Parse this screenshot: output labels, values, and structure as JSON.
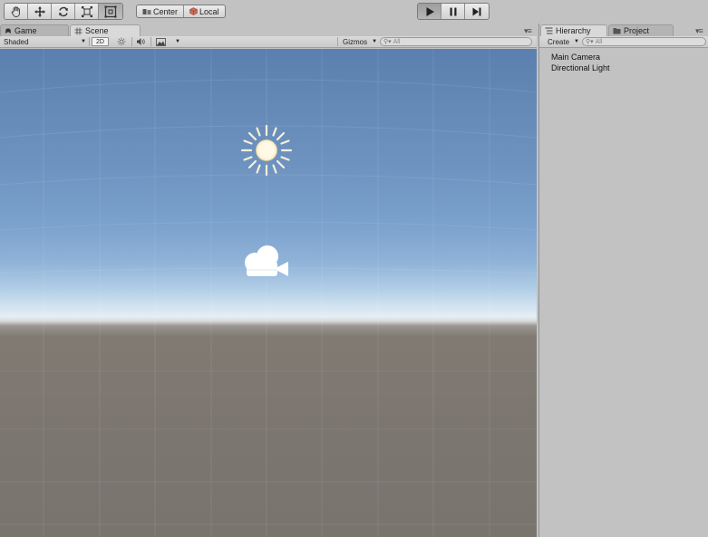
{
  "toolbar": {
    "tools": [
      "hand-tool",
      "move-tool",
      "rotate-tool",
      "scale-tool",
      "rect-tool"
    ],
    "active_tool": "rect-tool",
    "pivot_label": "Center",
    "space_label": "Local",
    "play_controls": [
      "play",
      "pause",
      "step"
    ],
    "active_control": "play"
  },
  "scene_panel": {
    "tabs": [
      {
        "label": "Game",
        "icon": "game-controller-icon",
        "active": false
      },
      {
        "label": "Scene",
        "icon": "grid-icon",
        "active": true
      }
    ],
    "render_mode": "Shaded",
    "mode_2d_label": "2D",
    "gizmos_label": "Gizmos",
    "search_placeholder": "All",
    "gizmos_in_view": [
      "sun-icon",
      "camera-icon"
    ]
  },
  "hierarchy_panel": {
    "tabs": [
      {
        "label": "Hierarchy",
        "icon": "list-icon",
        "active": true
      },
      {
        "label": "Project",
        "icon": "folder-icon",
        "active": false
      }
    ],
    "create_label": "Create",
    "search_placeholder": "All",
    "items": [
      "Main Camera",
      "Directional Light"
    ]
  },
  "colors": {
    "sky_top": "#5b7fae",
    "horizon": "#e6eef4",
    "ground": "#7c7670",
    "panel_bg": "#c2c2c2"
  }
}
